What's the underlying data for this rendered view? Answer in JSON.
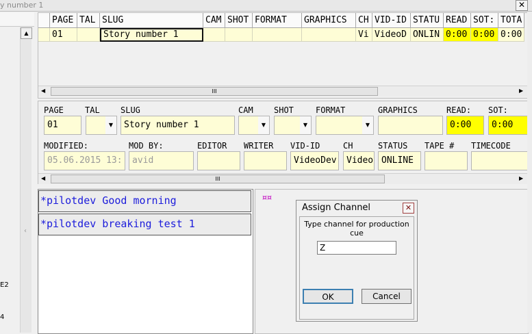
{
  "window": {
    "title_fragment": "y number 1",
    "close_glyph": "✕"
  },
  "left_panel": {
    "label_e2": "E2",
    "label_4": "4",
    "tick": "‹"
  },
  "grid": {
    "columns": [
      "PAGE",
      "TAL",
      "SLUG",
      "CAM",
      "SHOT",
      "FORMAT",
      "GRAPHICS",
      "CH",
      "VID-ID",
      "STATU",
      "READ",
      "SOT:",
      "TOTA"
    ],
    "row": [
      "01",
      "",
      "Story number 1",
      "",
      "",
      "",
      "",
      "Vi",
      "VideoD",
      "ONLIN",
      "0:00",
      "0:00",
      "0:00"
    ],
    "scroll_thumb": "III"
  },
  "form": {
    "labels": {
      "page": "PAGE",
      "tal": "TAL",
      "slug": "SLUG",
      "cam": "CAM",
      "shot": "SHOT",
      "format": "FORMAT",
      "graphics": "GRAPHICS",
      "read": "READ:",
      "sot": "SOT:",
      "modified": "MODIFIED:",
      "mod_by": "MOD BY:",
      "editor": "EDITOR",
      "writer": "WRITER",
      "vid_id": "VID-ID",
      "ch": "CH",
      "status": "STATUS",
      "tape": "TAPE #",
      "timecode": "TIMECODE"
    },
    "values": {
      "page": "01",
      "tal": "",
      "slug": "Story number 1",
      "cam": "",
      "shot": "",
      "format": "",
      "graphics": "",
      "read": "0:00",
      "sot": "0:00",
      "modified": "05.06.2015 13:",
      "mod_by": "avid",
      "editor": "",
      "writer": "",
      "vid_id": "VideoDev",
      "ch": "Video",
      "status": "ONLINE",
      "tape": "",
      "timecode": ""
    },
    "scroll_thumb": "III"
  },
  "chat": {
    "messages": [
      "*pilotdev Good morning",
      "*pilotdev breaking test 1"
    ]
  },
  "right_panel": {
    "marker": "¤¤"
  },
  "dialog": {
    "title": "Assign Channel",
    "close_glyph": "✕",
    "prompt_line1": "Type channel for production",
    "prompt_line2": "cue",
    "input_value": "Z",
    "ok_label": "OK",
    "cancel_label": "Cancel"
  },
  "icons": {
    "arrow_up": "▲",
    "arrow_down": "▼",
    "arrow_left": "◀",
    "arrow_right": "▶"
  }
}
